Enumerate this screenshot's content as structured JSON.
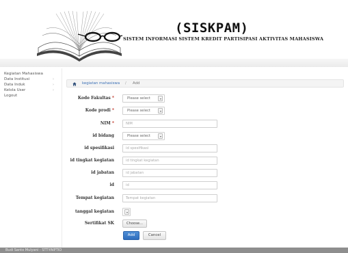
{
  "header": {
    "title": "(SISKPAM)",
    "subtitle": "SISTEM INFORMASI SISTEM KREDIT PARTISIPASI AKTIVITAS MAHASISWA"
  },
  "sidebar": {
    "items": [
      {
        "label": "Kegiatan Mahasiswa",
        "has_submenu": false
      },
      {
        "label": "Data Institusi",
        "has_submenu": true
      },
      {
        "label": "Data Induk",
        "has_submenu": true
      },
      {
        "label": "Kelola User",
        "has_submenu": true
      },
      {
        "label": "Logout",
        "has_submenu": false
      }
    ],
    "chevron": "›"
  },
  "breadcrumb": {
    "icon": "home-icon",
    "link": "kegiatan mahasiswa",
    "separator": "/",
    "current": "Add"
  },
  "form": {
    "kode_fakultas": {
      "label": "Kode Fakultas",
      "required": "*",
      "value": "Please select"
    },
    "kode_prodi": {
      "label": "Kode prodi",
      "required": "*",
      "value": "Please select"
    },
    "nim": {
      "label": "NIM",
      "required": "*",
      "placeholder": "NIM"
    },
    "id_bidang": {
      "label": "id bidang",
      "value": "Please select"
    },
    "id_spesifikasi": {
      "label": "id spesifikasi",
      "placeholder": "id spesifikasi"
    },
    "id_tingkat_kegiatan": {
      "label": "id tingkat kegiatan",
      "placeholder": "id tingkat kegiatan"
    },
    "id_jabatan": {
      "label": "id jabatan",
      "placeholder": "id jabatan"
    },
    "id": {
      "label": "id",
      "placeholder": "id"
    },
    "tempat_kegiatan": {
      "label": "Tempat kegiatan",
      "placeholder": "Tempat kegiatan"
    },
    "tanggal_kegiatan": {
      "label": "tanggal kegiatan"
    },
    "sertifikat_sk": {
      "label": "Sertifikat SK",
      "button": "Choose..."
    },
    "submit_label": "Add",
    "cancel_label": "Cancel"
  },
  "footer": {
    "text": "Budi Santo Mulyani - STT-YAIPTIO"
  },
  "colors": {
    "header_dark": "#1c1c1c",
    "link_blue": "#3a6fb5",
    "primary_button": "#2f6dbd",
    "required_star": "#c0392b",
    "footer_bg": "#8e8e8e"
  }
}
